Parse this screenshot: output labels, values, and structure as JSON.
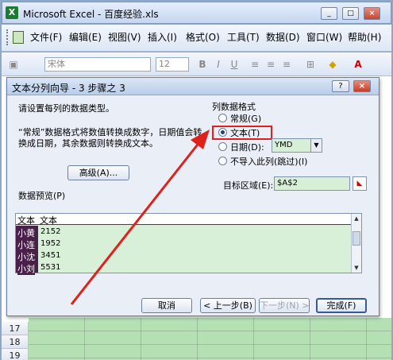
{
  "app": {
    "title": "Microsoft Excel - 百度经验.xls",
    "min_glyph": "_",
    "max_glyph": "□",
    "close_glyph": "×"
  },
  "menu": {
    "items": [
      "文件(F)",
      "编辑(E)",
      "视图(V)",
      "插入(I)",
      "格式(O)",
      "工具(T)",
      "数据(D)",
      "窗口(W)",
      "帮助(H)"
    ],
    "doc_close": "_ ▫ ×"
  },
  "toolbar": {
    "font_name": "宋体",
    "font_size": "12",
    "bold": "B",
    "italic": "I",
    "underline": "U",
    "font_color": "A"
  },
  "sheet": {
    "rows": [
      "17",
      "18",
      "19"
    ]
  },
  "dialog": {
    "title": "文本分列向导 - 3 步骤之 3",
    "help_glyph": "?",
    "close_glyph": "×",
    "instruction": "请设置每列的数据类型。",
    "description": "“常规”数据格式将数值转换成数字，日期值会转换成日期，其余数据则转换成文本。",
    "advanced_button": "高级(A)...",
    "column_format_label": "列数据格式",
    "options": {
      "general": "常规(G)",
      "text": "文本(T)",
      "date": "日期(D):",
      "skip": "不导入此列(跳过)(I)"
    },
    "selected_option": "text",
    "date_format": "YMD",
    "destination_label": "目标区域(E):",
    "destination_value": "$A$2",
    "preview_label": "数据预览(P)",
    "preview": {
      "headers": [
        "文本",
        "文本"
      ],
      "rows": [
        {
          "name": "小黄",
          "value": "2152"
        },
        {
          "name": "小连",
          "value": "1952"
        },
        {
          "name": "小沈",
          "value": "3451"
        },
        {
          "name": "小刘",
          "value": "5531"
        }
      ]
    },
    "buttons": {
      "cancel": "取消",
      "back": "< 上一步(B)",
      "next": "下一步(N) >",
      "finish": "完成(F)"
    }
  }
}
